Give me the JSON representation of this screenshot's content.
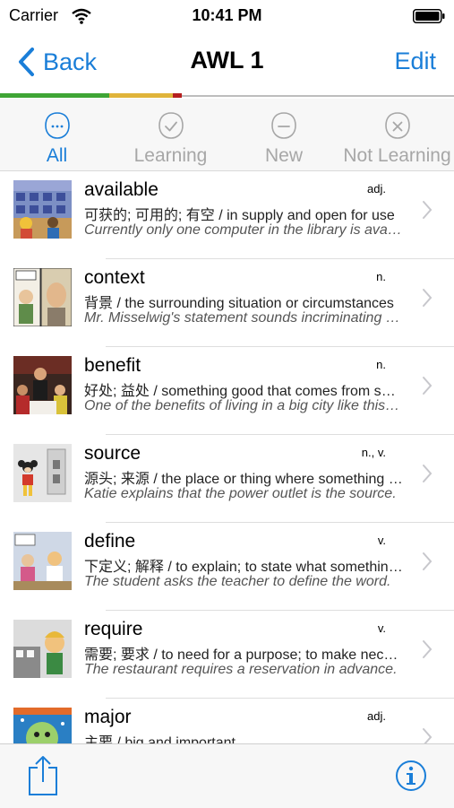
{
  "status_bar": {
    "carrier": "Carrier",
    "time": "10:41 PM"
  },
  "nav": {
    "back_label": "Back",
    "title": "AWL 1",
    "edit_label": "Edit"
  },
  "progress": {
    "learned": 0.24,
    "learning": 0.14,
    "not_learning": 0.02,
    "colors": {
      "learned": "#3fa535",
      "learning": "#e0b43a",
      "not_learning": "#b51f1f"
    }
  },
  "filters": [
    {
      "label": "All",
      "icon": "neutral-face-icon",
      "selected": true
    },
    {
      "label": "Learning",
      "icon": "check-circle-face-icon",
      "selected": false
    },
    {
      "label": "New",
      "icon": "dash-face-icon",
      "selected": false
    },
    {
      "label": "Not Learning",
      "icon": "x-circle-face-icon",
      "selected": false
    }
  ],
  "words": [
    {
      "word": "available",
      "pos": "adj.",
      "meaning": "可获的; 可用的; 有空 / in supply and open for use",
      "example": "Currently only one computer in the library is available.",
      "thumb": "classroom-computers-image"
    },
    {
      "word": "context",
      "pos": "n.",
      "meaning": "背景 / the surrounding situation or circumstances",
      "example": "Mr. Misselwig's statement sounds incriminating out of context.",
      "thumb": "comic-panel-image"
    },
    {
      "word": "benefit",
      "pos": "n.",
      "meaning": "好处; 益处 / something good that comes from something",
      "example": "One of the benefits of living in a big city like this one.",
      "thumb": "restaurant-scene-image"
    },
    {
      "word": "source",
      "pos": "n., v.",
      "meaning": "源头; 来源 / the place or thing where something comes from",
      "example": "Katie explains that the power outlet is the source.",
      "thumb": "power-outlet-image"
    },
    {
      "word": "define",
      "pos": "v.",
      "meaning": "下定义; 解释 / to explain; to state what something means",
      "example": "The student asks the teacher to define the word.",
      "thumb": "classroom-question-image"
    },
    {
      "word": "require",
      "pos": "v.",
      "meaning": "需要; 要求 / to need for a purpose; to make necessary",
      "example": "The restaurant requires a reservation in advance.",
      "thumb": "cartoon-restaurant-image"
    },
    {
      "word": "major",
      "pos": "adj.",
      "meaning": "主要 / big and important",
      "example": "",
      "thumb": "space-illustration-image"
    }
  ]
}
